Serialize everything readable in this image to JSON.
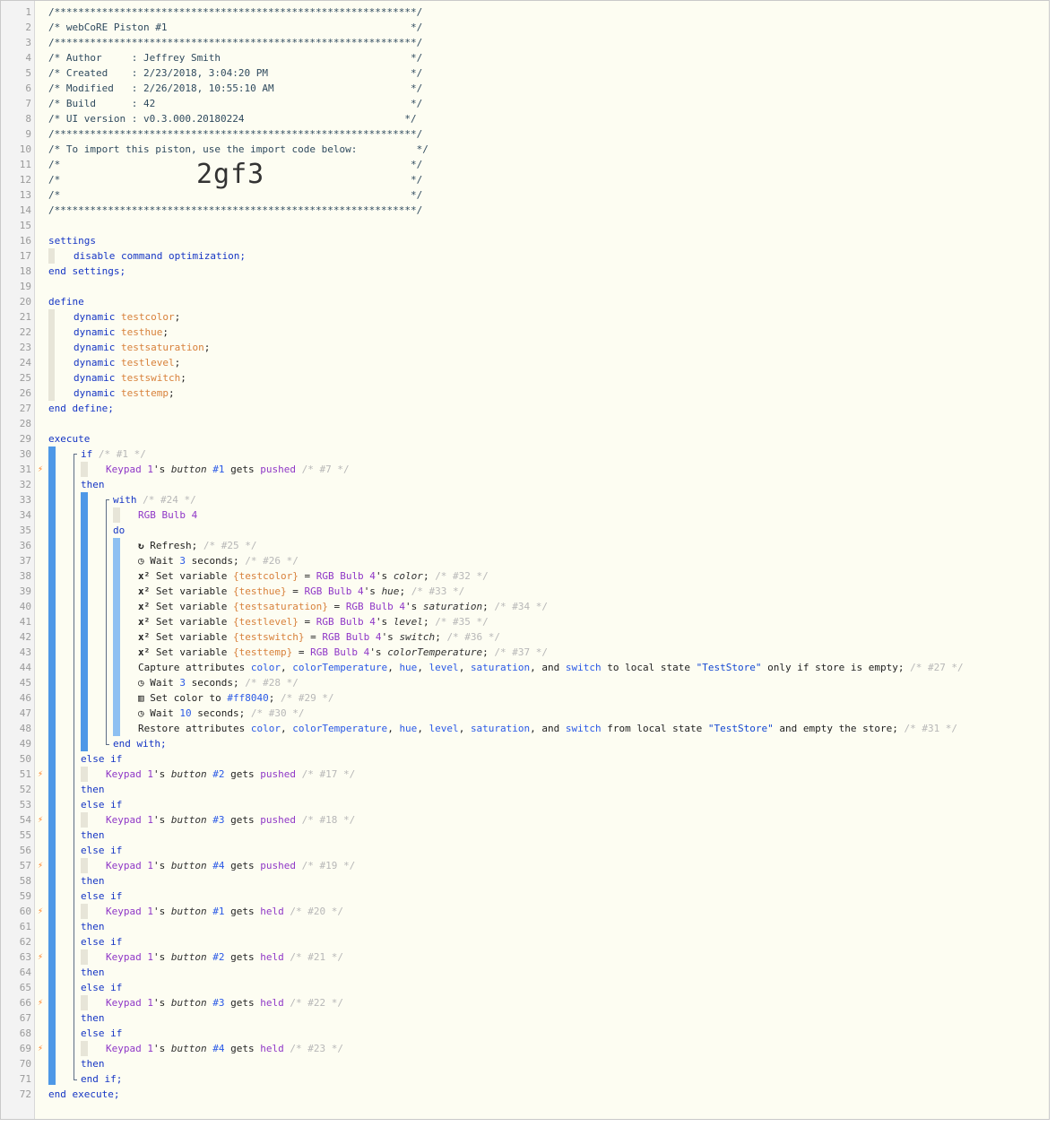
{
  "line_numbers": [
    "1",
    "2",
    "3",
    "4",
    "5",
    "6",
    "7",
    "8",
    "9",
    "10",
    "11",
    "12",
    "13",
    "14",
    "15",
    "16",
    "17",
    "18",
    "19",
    "20",
    "21",
    "22",
    "23",
    "24",
    "25",
    "26",
    "27",
    "28",
    "29",
    "30",
    "31",
    "32",
    "33",
    "34",
    "35",
    "36",
    "37",
    "38",
    "39",
    "40",
    "41",
    "42",
    "43",
    "44",
    "45",
    "46",
    "47",
    "48",
    "49",
    "50",
    "51",
    "52",
    "53",
    "54",
    "55",
    "56",
    "57",
    "58",
    "59",
    "60",
    "61",
    "62",
    "63",
    "64",
    "65",
    "66",
    "67",
    "68",
    "69",
    "70",
    "71",
    "72"
  ],
  "header": {
    "border": "/*************************************************************/",
    "title": "/* webCoRE Piston #1                                         */",
    "author": "/* Author     : Jeffrey Smith                                */",
    "created": "/* Created    : 2/23/2018, 3:04:20 PM                        */",
    "modified": "/* Modified   : 2/26/2018, 10:55:10 AM                       */",
    "build": "/* Build      : 42                                           */",
    "ui_version": "/* UI version : v0.3.000.20180224                           */",
    "import_text": "/* To import this piston, use the import code below:          */",
    "blank": "/*                                                           */",
    "import_code": "2gf3"
  },
  "settings": {
    "open": "settings",
    "line": "disable command optimization;",
    "close": "end settings;"
  },
  "define": {
    "open": "define",
    "keyword": "dynamic",
    "vars": [
      "testcolor",
      "testhue",
      "testsaturation",
      "testlevel",
      "testswitch",
      "testtemp"
    ],
    "semicolon": ";",
    "close": "end define;"
  },
  "execute": {
    "open": "execute",
    "close": "end execute;",
    "if_kw": "if",
    "else_if_kw": "else if",
    "then_kw": "then",
    "end_if": "end if;",
    "with_kw": "with",
    "do_kw": "do",
    "end_with": "end with;",
    "device_keypad": "Keypad 1",
    "poss": "'s ",
    "button_word": "button",
    "gets": " gets ",
    "device_rgb": "RGB Bulb 4",
    "comment_if": "/* #1 */",
    "comment_with": "/* #24 */"
  },
  "conditions": [
    {
      "btn": "#1",
      "action": "pushed",
      "comment": "/* #7 */"
    },
    {
      "btn": "#2",
      "action": "pushed",
      "comment": "/* #17 */"
    },
    {
      "btn": "#3",
      "action": "pushed",
      "comment": "/* #18 */"
    },
    {
      "btn": "#4",
      "action": "pushed",
      "comment": "/* #19 */"
    },
    {
      "btn": "#1",
      "action": "held",
      "comment": "/* #20 */"
    },
    {
      "btn": "#2",
      "action": "held",
      "comment": "/* #21 */"
    },
    {
      "btn": "#3",
      "action": "held",
      "comment": "/* #22 */"
    },
    {
      "btn": "#4",
      "action": "held",
      "comment": "/* #23 */"
    }
  ],
  "statements": {
    "refresh": {
      "icon": "↻",
      "text": "Refresh;",
      "comment": "/* #25 */"
    },
    "wait1": {
      "icon": "◷",
      "pre": "Wait ",
      "num": "3",
      "post": " seconds;",
      "comment": "/* #26 */"
    },
    "set_vars": [
      {
        "var": "{testcolor}",
        "attr": "color",
        "comment": "/* #32 */"
      },
      {
        "var": "{testhue}",
        "attr": "hue",
        "comment": "/* #33 */"
      },
      {
        "var": "{testsaturation}",
        "attr": "saturation",
        "comment": "/* #34 */"
      },
      {
        "var": "{testlevel}",
        "attr": "level",
        "comment": "/* #35 */"
      },
      {
        "var": "{testswitch}",
        "attr": "switch",
        "comment": "/* #36 */"
      },
      {
        "var": "{testtemp}",
        "attr": "colorTemperature",
        "comment": "/* #37 */"
      }
    ],
    "set_icon": "x²",
    "set_prefix": "Set variable ",
    "set_eq": " = ",
    "capture": {
      "pre": "Capture attributes ",
      "attrs": [
        "color",
        "colorTemperature",
        "hue",
        "level",
        "saturation"
      ],
      "and": ", and ",
      "last": "switch",
      "mid": " to local state ",
      "store": "\"TestStore\"",
      "post": " only if store is empty;",
      "comment": "/* #27 */"
    },
    "wait2": {
      "icon": "◷",
      "pre": "Wait ",
      "num": "3",
      "post": " seconds;",
      "comment": "/* #28 */"
    },
    "setcolor": {
      "icon": "▥",
      "pre": "Set color to ",
      "val": "#ff8040",
      "post": ";",
      "comment": "/* #29 */"
    },
    "wait3": {
      "icon": "◷",
      "pre": "Wait ",
      "num": "10",
      "post": " seconds;",
      "comment": "/* #30 */"
    },
    "restore": {
      "pre": "Restore attributes ",
      "mid": " from local state ",
      "post": " and empty the store;",
      "comment": "/* #31 */"
    }
  },
  "colors": {
    "background": "#fdfdf2",
    "gutter": "#f3f3f3",
    "keyword": "#1535c4",
    "device": "#8f37c7",
    "variable": "#d8813b",
    "comment": "#b7b7b7",
    "block_bar": "#4e98e7",
    "trigger_flag": "#ff7a1a"
  },
  "trigger_lines": [
    "31",
    "51",
    "54",
    "57",
    "60",
    "63",
    "66",
    "69"
  ]
}
